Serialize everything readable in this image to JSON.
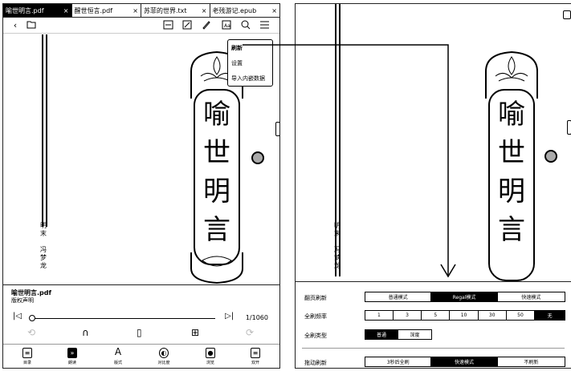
{
  "tabs": [
    {
      "label": "喻世明言.pdf",
      "close": "×"
    },
    {
      "label": "醒世恒言.pdf",
      "close": "×"
    },
    {
      "label": "苏菲的世界.txt",
      "close": "×"
    },
    {
      "label": "老残游记.epub",
      "close": "×"
    }
  ],
  "menu": {
    "items": [
      "刷新",
      "设置",
      "导入内嵌数据"
    ]
  },
  "cover": {
    "title_chars": [
      "喻",
      "世",
      "明",
      "言"
    ],
    "author_left": [
      "明",
      "末",
      "",
      "冯",
      "梦",
      "龙"
    ],
    "author_right": [
      "明",
      "末",
      "",
      "冯",
      "梦",
      "龙"
    ]
  },
  "bottom": {
    "book_title": "喻世明言.pdf",
    "book_subtitle": "版权声明",
    "page_indicator": "1/1060"
  },
  "navbar": [
    {
      "label": "目录",
      "icon": "list-icon"
    },
    {
      "label": "朗读",
      "icon": "read-aloud-icon"
    },
    {
      "label": "版式",
      "icon": "font-icon"
    },
    {
      "label": "对比度",
      "icon": "contrast-icon"
    },
    {
      "label": "浏览",
      "icon": "browse-icon"
    },
    {
      "label": "双开",
      "icon": "split-icon"
    }
  ],
  "panel": {
    "page_turn_refresh": {
      "label": "翻页刷新",
      "options": [
        "普通模式",
        "Regal模式",
        "快速模式"
      ],
      "selected": 1
    },
    "full_refresh_freq": {
      "label": "全刷频率",
      "options": [
        "1",
        "3",
        "5",
        "10",
        "30",
        "50",
        "无"
      ],
      "selected": 6
    },
    "full_refresh_type": {
      "label": "全刷类型",
      "options": [
        "普通",
        "深度"
      ],
      "selected": 0
    },
    "drag_refresh": {
      "label": "拖动刷新",
      "options": [
        "3秒后全刷",
        "快速模式",
        "不刷新"
      ],
      "selected": 1
    }
  }
}
